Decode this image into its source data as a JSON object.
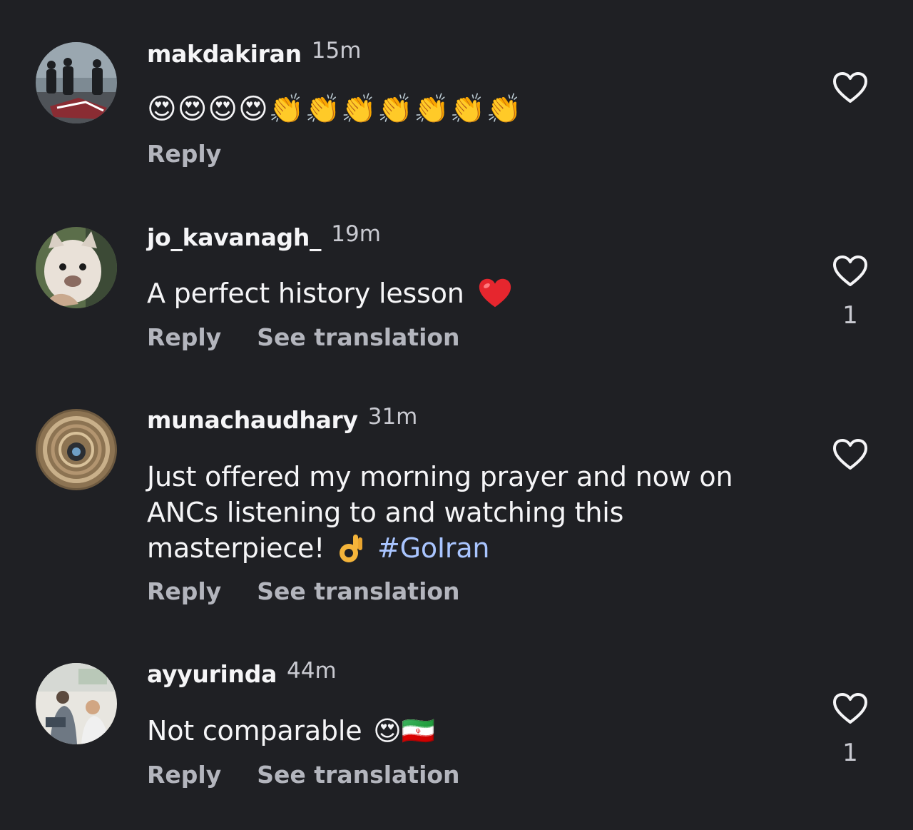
{
  "comments": [
    {
      "username": "makdakiran",
      "time": "15m",
      "text": "😍😍😍😍👏👏👏👏👏👏👏",
      "reply_label": "Reply",
      "likes": ""
    },
    {
      "username": "jo_kavanagh_",
      "time": "19m",
      "text": "A perfect history lesson",
      "text_emoji": "❤️",
      "reply_label": "Reply",
      "translate_label": "See translation",
      "likes": "1"
    },
    {
      "username": "munachaudhary",
      "time": "31m",
      "text_line1": "Just offered my morning prayer and now on",
      "text_line2": "ANCs listening to and watching this",
      "text_line3": "masterpiece!",
      "text_emoji": "👌",
      "hashtag": "#GoIran",
      "reply_label": "Reply",
      "translate_label": "See translation",
      "likes": ""
    },
    {
      "username": "ayyurinda",
      "time": "44m",
      "text": "Not comparable",
      "text_emoji": "😍🇮🇷",
      "reply_label": "Reply",
      "translate_label": "See translation",
      "likes": "1"
    }
  ],
  "icons": {
    "like": "heart-outline-icon",
    "heart_emoji": "red-heart-emoji",
    "ok_emoji": "ok-hand-emoji"
  },
  "colors": {
    "background": "#1f2024",
    "text": "#f5f5f7",
    "secondary": "#b3b5bd",
    "hashtag": "#a9c5ff"
  }
}
